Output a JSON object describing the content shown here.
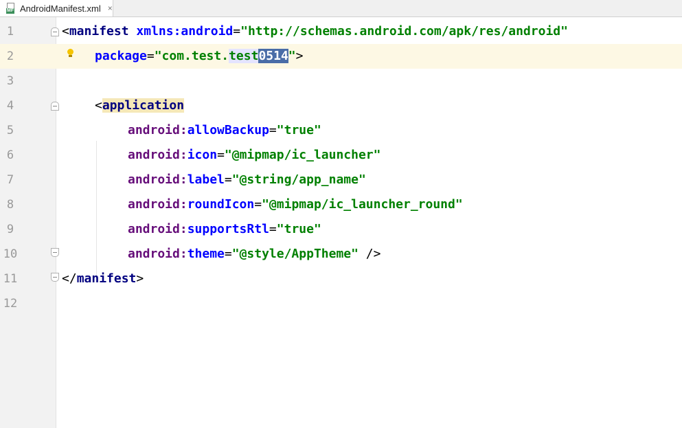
{
  "tab": {
    "label": "AndroidManifest.xml",
    "icon": "xml-file-icon",
    "close": "×",
    "badge": "MF"
  },
  "gutter": {
    "line_numbers": [
      "1",
      "2",
      "3",
      "4",
      "5",
      "6",
      "7",
      "8",
      "9",
      "10",
      "11",
      "12"
    ]
  },
  "code": {
    "l1": {
      "open": "<",
      "tag": "manifest",
      "sp": " ",
      "attr": "xmlns:android",
      "eq": "=",
      "val": "\"http://schemas.android.com/apk/res/android\""
    },
    "l2": {
      "attr": "package",
      "eq": "=",
      "val_a": "\"com.test.",
      "val_hl": "test",
      "val_sel": "0514",
      "val_b": "\"",
      "close": ">"
    },
    "l4": {
      "open": "<",
      "tag": "application"
    },
    "l5": {
      "ns": "android:",
      "attr": "allowBackup",
      "eq": "=",
      "val": "\"true\""
    },
    "l6": {
      "ns": "android:",
      "attr": "icon",
      "eq": "=",
      "val": "\"@mipmap/ic_launcher\""
    },
    "l7": {
      "ns": "android:",
      "attr": "label",
      "eq": "=",
      "val": "\"@string/app_name\""
    },
    "l8": {
      "ns": "android:",
      "attr": "roundIcon",
      "eq": "=",
      "val": "\"@mipmap/ic_launcher_round\""
    },
    "l9": {
      "ns": "android:",
      "attr": "supportsRtl",
      "eq": "=",
      "val": "\"true\""
    },
    "l10": {
      "ns": "android:",
      "attr": "theme",
      "eq": "=",
      "val": "\"@style/AppTheme\"",
      "close": " />"
    },
    "l11": {
      "open": "</",
      "tag": "manifest",
      "close": ">"
    }
  },
  "colors": {
    "tag": "#000080",
    "attr": "#0000ff",
    "namespace": "#660e7a",
    "value": "#008000",
    "selection": "#4a6da7",
    "current_line": "#fdf8e4"
  }
}
